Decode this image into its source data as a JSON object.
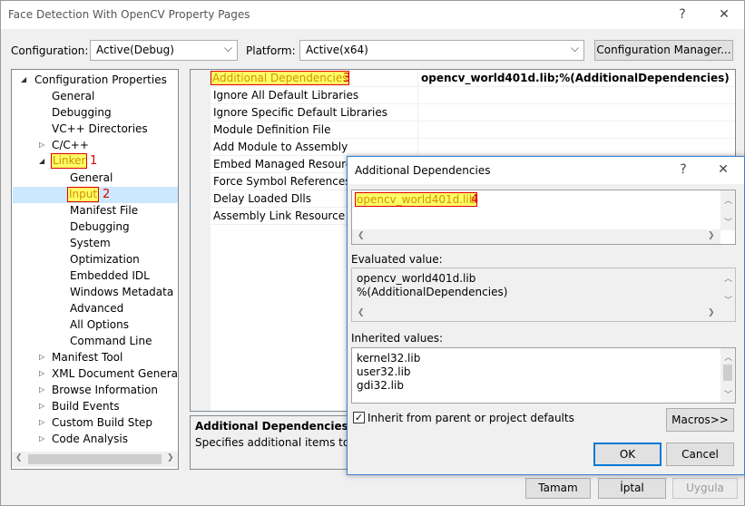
{
  "window": {
    "title": "Face Detection With OpenCV Property Pages",
    "help": "?",
    "close": "✕"
  },
  "toolbar": {
    "configuration_label": "Configuration:",
    "configuration_value": "Active(Debug)",
    "platform_label": "Platform:",
    "platform_value": "Active(x64)",
    "config_manager": "Configuration Manager..."
  },
  "tree": {
    "root": "Configuration Properties",
    "items": [
      "General",
      "Debugging",
      "VC++ Directories",
      "C/C++",
      "Linker",
      "General",
      "Input",
      "Manifest File",
      "Debugging",
      "System",
      "Optimization",
      "Embedded IDL",
      "Windows Metadata",
      "Advanced",
      "All Options",
      "Command Line",
      "Manifest Tool",
      "XML Document Generator",
      "Browse Information",
      "Build Events",
      "Custom Build Step",
      "Code Analysis"
    ],
    "linker_marker": "1",
    "input_marker": "2"
  },
  "grid": {
    "rows": [
      {
        "name": "Additional Dependencies",
        "value": "opencv_world401d.lib;%(AdditionalDependencies)"
      },
      {
        "name": "Ignore All Default Libraries",
        "value": ""
      },
      {
        "name": "Ignore Specific Default Libraries",
        "value": ""
      },
      {
        "name": "Module Definition File",
        "value": ""
      },
      {
        "name": "Add Module to Assembly",
        "value": ""
      },
      {
        "name": "Embed Managed Resource File",
        "value": ""
      },
      {
        "name": "Force Symbol References",
        "value": ""
      },
      {
        "name": "Delay Loaded Dlls",
        "value": ""
      },
      {
        "name": "Assembly Link Resource",
        "value": ""
      }
    ],
    "marker": "3"
  },
  "description": {
    "title": "Additional Dependencies",
    "text": "Specifies additional items to add to the link command line"
  },
  "footer": {
    "ok": "Tamam",
    "cancel": "İptal",
    "apply": "Uygula"
  },
  "dialog": {
    "title": "Additional Dependencies",
    "help": "?",
    "close": "✕",
    "edit_value": "opencv_world401d.lib",
    "edit_marker": "4",
    "evaluated_label": "Evaluated value:",
    "evaluated_lines": [
      "opencv_world401d.lib",
      "%(AdditionalDependencies)"
    ],
    "inherited_label": "Inherited values:",
    "inherited_lines": [
      "kernel32.lib",
      "user32.lib",
      "gdi32.lib"
    ],
    "inherit_checkbox": "Inherit from parent or project defaults",
    "macros": "Macros>>",
    "ok": "OK",
    "cancel": "Cancel"
  }
}
